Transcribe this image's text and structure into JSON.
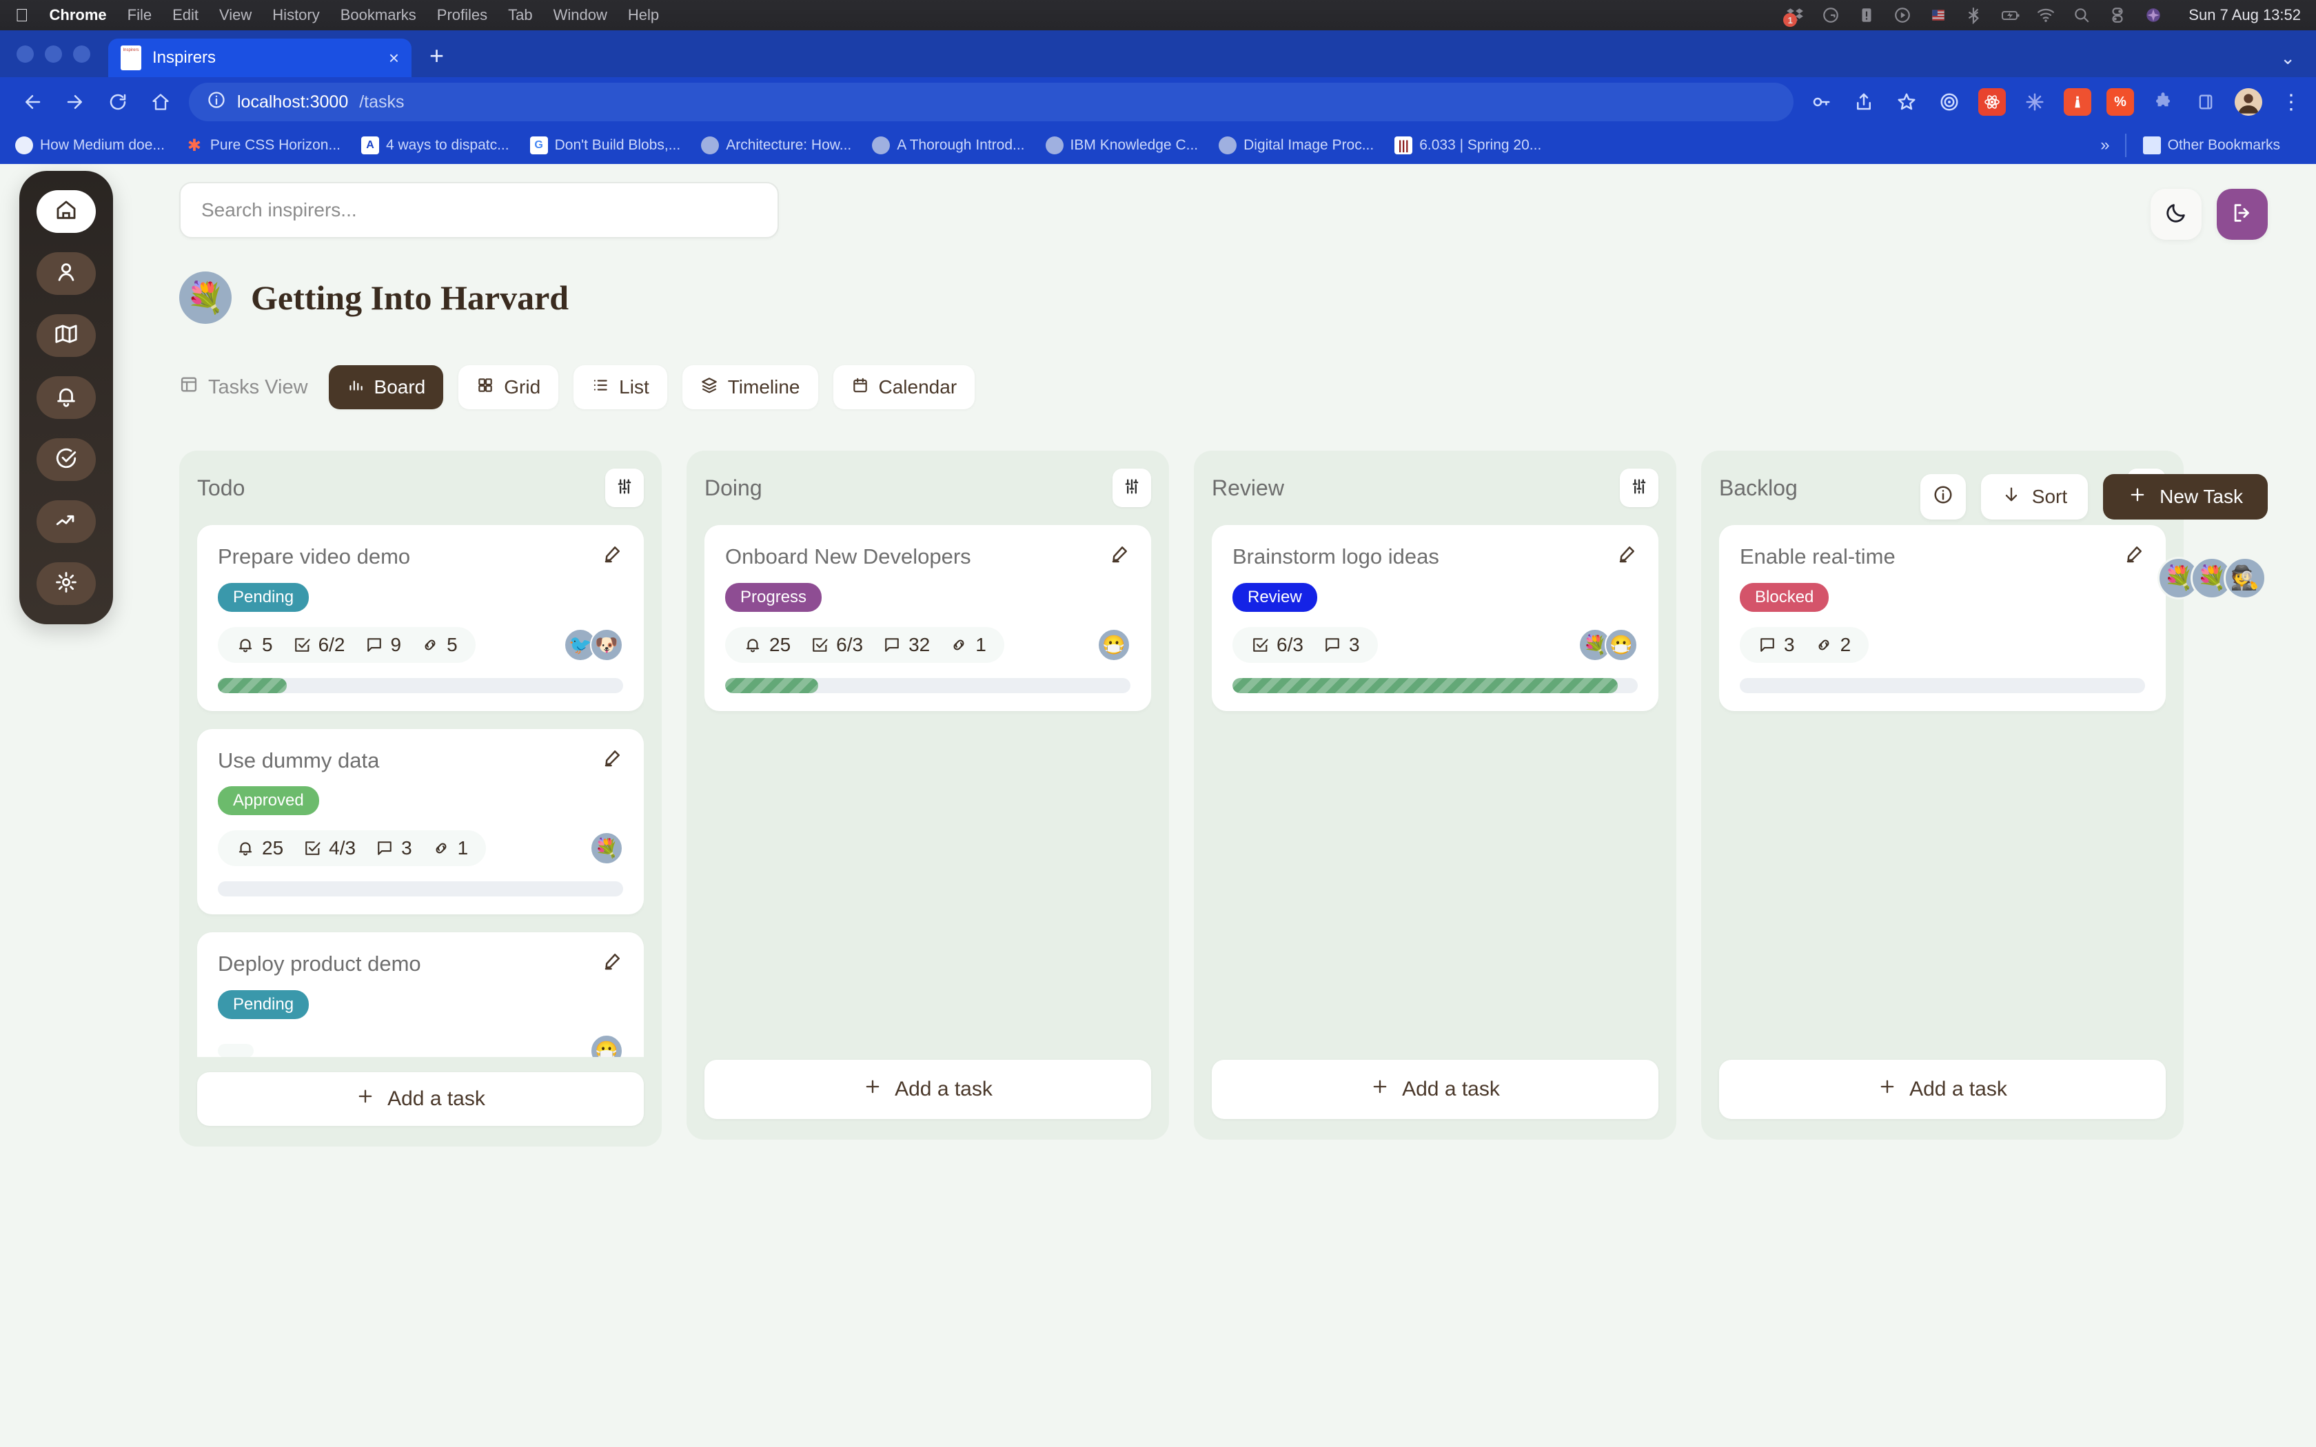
{
  "macos": {
    "apple_glyph": "",
    "menus": [
      "Chrome",
      "File",
      "Edit",
      "View",
      "History",
      "Bookmarks",
      "Profiles",
      "Tab",
      "Window",
      "Help"
    ],
    "tray_badge": "1",
    "tray_icons": [
      "dropbox-icon",
      "grammarly-icon",
      "alert-icon",
      "play-circle-icon",
      "flag-icon",
      "bluetooth-icon",
      "battery-charging-icon",
      "wifi-icon",
      "search-icon",
      "control-center-icon",
      "siri-icon"
    ],
    "clock": "Sun 7 Aug  13:52"
  },
  "browser": {
    "tab_title": "Inspirers",
    "favicon_label": "Inspirers",
    "close_glyph": "×",
    "new_tab_glyph": "+",
    "window_caret": "⌄",
    "url_host": "localhost:3000",
    "url_path": "/tasks",
    "nav": [
      "back-arrow",
      "forward-arrow",
      "reload",
      "home"
    ],
    "omni_actions": [
      "key-icon",
      "share-icon",
      "bookmark-star-icon"
    ],
    "extensions": [
      "target-icon",
      "react-devtools-icon",
      "asterisk-icon",
      "lighthouse-icon",
      "percent-icon",
      "puzzle-icon",
      "sidepanel-icon"
    ],
    "profile_avatar": "avatar-icon",
    "menu_glyph": "⋮",
    "bookmarks": [
      {
        "label": "How Medium doe...",
        "icon": "globe-icon"
      },
      {
        "label": "Pure CSS Horizon...",
        "icon": "asterisk-icon"
      },
      {
        "label": "4 ways to dispatc...",
        "icon": "angular-icon"
      },
      {
        "label": "Don't Build Blobs,...",
        "icon": "google-icon"
      },
      {
        "label": "Architecture: How...",
        "icon": "globe-icon"
      },
      {
        "label": "A Thorough Introd...",
        "icon": "globe-icon"
      },
      {
        "label": "IBM Knowledge C...",
        "icon": "globe-icon"
      },
      {
        "label": "Digital Image Proc...",
        "icon": "globe-icon"
      },
      {
        "label": "6.033 | Spring 20...",
        "icon": "mit-icon"
      }
    ],
    "overflow_glyph": "»",
    "other_bookmarks": "Other Bookmarks"
  },
  "app": {
    "sidebar": [
      {
        "name": "home",
        "icon": "home-icon",
        "active": true
      },
      {
        "name": "profile",
        "icon": "user-icon",
        "active": false
      },
      {
        "name": "map",
        "icon": "map-icon",
        "active": false
      },
      {
        "name": "notifications",
        "icon": "bell-icon",
        "active": false
      },
      {
        "name": "tasks",
        "icon": "check-circle-icon",
        "active": false
      },
      {
        "name": "analytics",
        "icon": "trending-up-icon",
        "active": false
      },
      {
        "name": "settings",
        "icon": "gear-icon",
        "active": false
      }
    ],
    "search": {
      "placeholder": "Search inspirers...",
      "value": ""
    },
    "theme_toggle": "moon-icon",
    "logout": "logout-icon",
    "project": {
      "title": "Getting Into Harvard",
      "avatar": "💐"
    },
    "actions": {
      "info_label": "i",
      "sort_label": "Sort",
      "sort_icon": "arrow-down-icon",
      "new_task_label": "New Task",
      "new_task_icon": "plus-icon"
    },
    "views": {
      "label": "Tasks View",
      "label_icon": "layout-icon",
      "tabs": [
        {
          "label": "Board",
          "icon": "bar-chart-icon",
          "active": true
        },
        {
          "label": "Grid",
          "icon": "grid-icon",
          "active": false
        },
        {
          "label": "List",
          "icon": "list-icon",
          "active": false
        },
        {
          "label": "Timeline",
          "icon": "layers-icon",
          "active": false
        },
        {
          "label": "Calendar",
          "icon": "calendar-icon",
          "active": false
        }
      ]
    },
    "members": [
      {
        "name": "member-bouquet-1",
        "emoji": "💐"
      },
      {
        "name": "member-bouquet-2",
        "emoji": "💐"
      },
      {
        "name": "member-heisenberg",
        "emoji": "🕵️"
      }
    ],
    "add_task_label": "Add a task",
    "add_task_icon": "plus-icon",
    "filter_icon": "sliders-icon",
    "edit_icon": "pencil-icon",
    "meta_icons": {
      "bell": "bell-icon",
      "checklist": "checkbox-icon",
      "comments": "message-icon",
      "links": "link-icon"
    },
    "status_colors": {
      "Pending": "#3a98ab",
      "Approved": "#6cbb6c",
      "Progress": "#8e4d93",
      "Review": "#1423e6",
      "Blocked": "#d4546a"
    },
    "columns": [
      {
        "title": "Todo",
        "cards": [
          {
            "title": "Prepare video demo",
            "status": "Pending",
            "bell": "5",
            "checklist": "6/2",
            "comments": "9",
            "links": "5",
            "progress": 17,
            "avatars": [
              "🐦",
              "🐶"
            ]
          },
          {
            "title": "Use dummy data",
            "status": "Approved",
            "bell": "25",
            "checklist": "4/3",
            "comments": "3",
            "links": "1",
            "progress": 0,
            "avatars": [
              "💐"
            ]
          },
          {
            "title": "Deploy product demo",
            "status": "Pending",
            "bell": "",
            "checklist": "",
            "comments": "",
            "links": "",
            "progress": 0,
            "avatars": [
              "😷"
            ]
          }
        ]
      },
      {
        "title": "Doing",
        "cards": [
          {
            "title": "Onboard New Developers",
            "status": "Progress",
            "bell": "25",
            "checklist": "6/3",
            "comments": "32",
            "links": "1",
            "progress": 23,
            "avatars": [
              "😷"
            ]
          }
        ]
      },
      {
        "title": "Review",
        "cards": [
          {
            "title": "Brainstorm logo ideas",
            "status": "Review",
            "bell": "",
            "checklist": "6/3",
            "comments": "3",
            "links": "",
            "progress": 95,
            "avatars": [
              "💐",
              "😷"
            ]
          }
        ]
      },
      {
        "title": "Backlog",
        "cards": [
          {
            "title": "Enable real-time",
            "status": "Blocked",
            "bell": "",
            "checklist": "",
            "comments": "3",
            "links": "2",
            "progress": 0,
            "avatars": []
          }
        ]
      }
    ]
  }
}
